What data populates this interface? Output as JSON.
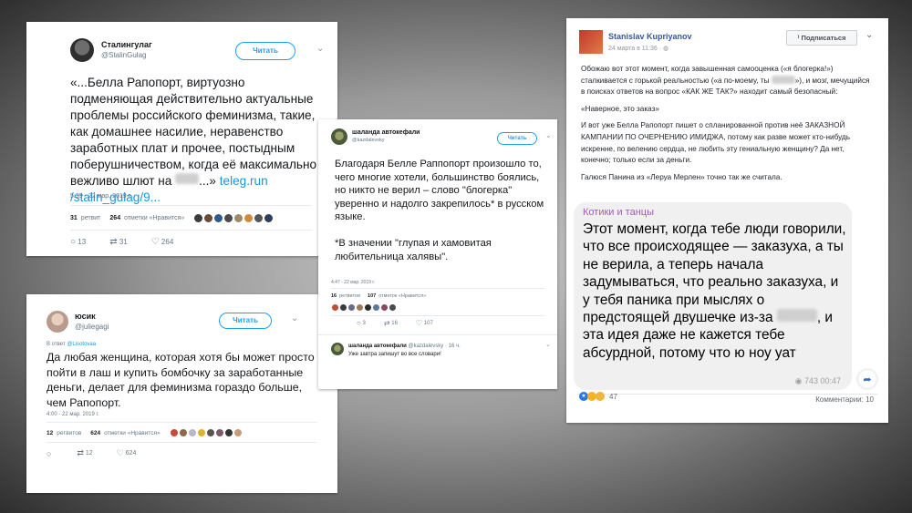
{
  "tweet1": {
    "name": "Сталингулаг",
    "handle": "@StalinGulag",
    "follow": "Читать",
    "text_before": "«...Белла Рапопорт, виртуозно подменяющая действительно актуальные проблемы российского феминизма, такие, как домашнее насилие, неравенство заработных плат и прочее, постыдным поберушничеством, когда её максимально вежливо шлют на",
    "text_after": "...»",
    "link": "teleg.run /stalin_gulag/9...",
    "timestamp": "5:39 - 22 мар. 2019 г.",
    "retweets": "31",
    "retweets_label": "ретвит",
    "likes": "264",
    "likes_label": "отметки «Нравится»",
    "replies_count": "13",
    "rt_count": "31",
    "heart_count": "264"
  },
  "tweet2": {
    "name": "юсик",
    "handle": "@juliegagi",
    "follow": "Читать",
    "reply_to_prefix": "В ответ",
    "reply_to": "@Lisotovaa",
    "text": "Да любая женщина, которая хотя бы может просто пойти в лаш и купить бомбочку за заработанные деньги, делает для феминизма гораздо больше, чем Рапопорт.",
    "timestamp": "4:00 - 22 мар. 2019 г.",
    "retweets": "12",
    "retweets_label": "ретвитов",
    "likes": "624",
    "likes_label": "отметки «Нравится»",
    "replies_count": "",
    "rt_count": "12",
    "heart_count": "624"
  },
  "tweet3": {
    "name": "шаланда автокефали",
    "handle": "@kazdalevsky",
    "follow": "Читать",
    "text1": "Благодаря Белле Раппопорт произошло то, чего многие хотели, большинство боялись, но никто не верил – слово \"блогерка\" уверенно и надолго закрепилось* в русском языке.",
    "text2": "*В значении \"глупая и хамовитая любительница халявы\".",
    "timestamp": "4:47 - 22 мар. 2019 г.",
    "retweets": "16",
    "retweets_label": "ретвитов",
    "likes": "107",
    "likes_label": "отметок «Нравится»",
    "replies_count": "3",
    "rt_count": "16",
    "heart_count": "107",
    "reply": {
      "name": "шаланда автокефали",
      "handle": "@kazdalevsky · 16 ч.",
      "text": "Уже завтра запишут во все словари!"
    }
  },
  "fbpost": {
    "name": "Stanislav Kupriyanov",
    "date": "24 марта в 11:36 ·",
    "subscribe": "Подписаться",
    "p1_a": "Обожаю вот этот момент, когда завышенная самооценка («я блогерка!») сталкивается с горькой реальностью («а по-моему, ты",
    "p1_b": "»), и мозг, мечущийся в поисках ответов на вопрос «КАК ЖЕ ТАК?» находит самый безопасный:",
    "p2": "«Наверное, это заказ»",
    "p3": "И вот уже Белла Рапопорт пишет о спланированной против неё ЗАКАЗНОЙ КАМПАНИИ ПО ОЧЕРНЕНИЮ ИМИДЖА, потому как разве может кто-нибудь искренне, по велению сердца, не любить эту гениальную женщину? Да нет, конечно; только если за деньги.",
    "p4": "Галюся Панина из «Леруа Мерлен» точно так же считала.",
    "bubble_title": "Котики и танцы",
    "bubble_a": "Этот момент, когда тебе люди говорили, что все происходящее — заказуха, а ты не верила, а теперь начала задумываться, что реально заказуха, и у тебя паника при мыслях о предстоящей двушечке из-за",
    "bubble_b": ", и эта идея даже не кажется тебе абсурдной, потому что ю ноу уат",
    "bubble_meta": "743 00:47",
    "reactions": "47",
    "comments": "Комментарии: 10"
  }
}
